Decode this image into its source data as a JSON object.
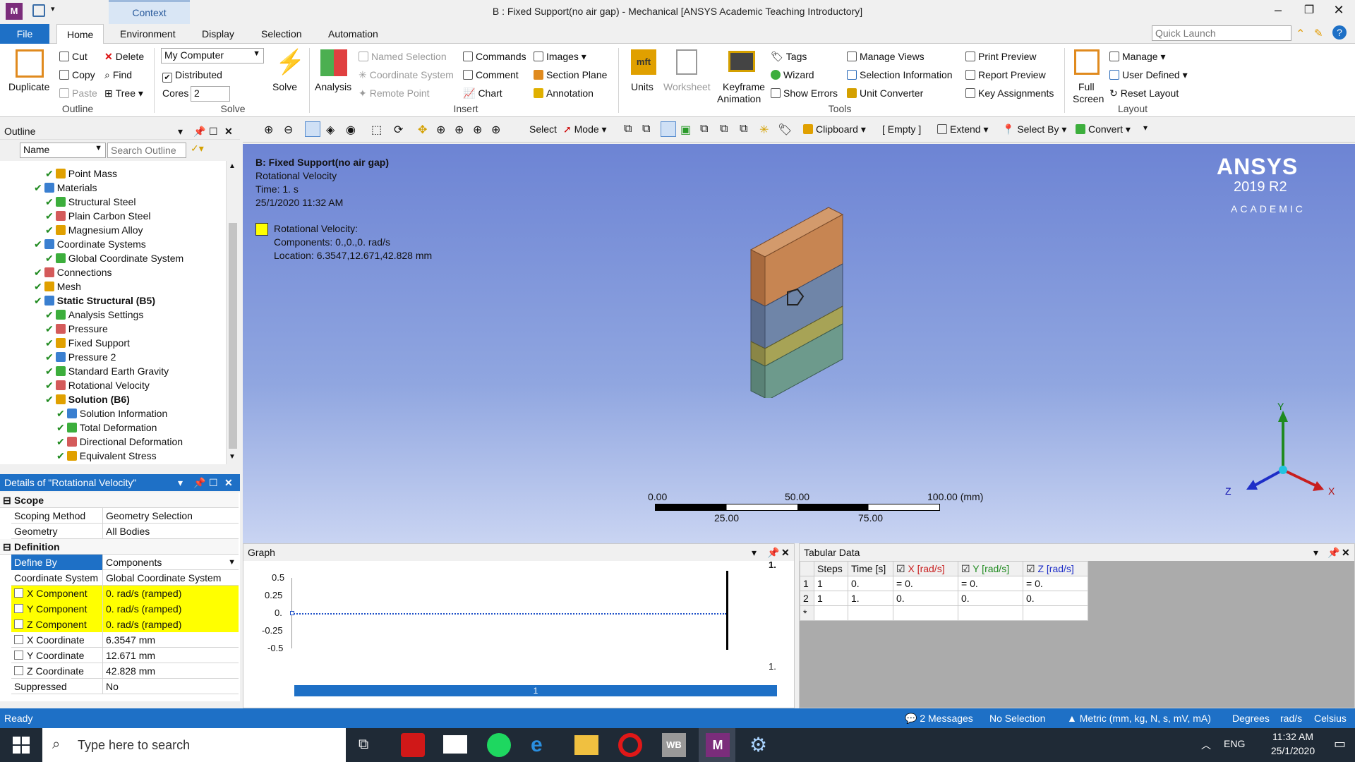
{
  "window": {
    "title": "B : Fixed Support(no air gap) - Mechanical [ANSYS Academic Teaching Introductory]",
    "context_tab": "Context"
  },
  "menu": {
    "file": "File",
    "tabs": [
      "Home",
      "Environment",
      "Display",
      "Selection",
      "Automation"
    ],
    "quick_launch_placeholder": "Quick Launch"
  },
  "ribbon": {
    "outline": {
      "duplicate": "Duplicate",
      "cut": "Cut",
      "copy": "Copy",
      "paste": "Paste",
      "delete": "Delete",
      "find": "Find",
      "tree": "Tree",
      "group": "Outline"
    },
    "solve": {
      "computer": "My Computer",
      "distributed": "Distributed",
      "cores_label": "Cores",
      "cores_value": "2",
      "solve": "Solve",
      "group": "Solve"
    },
    "insert": {
      "analysis": "Analysis",
      "named_selection": "Named Selection",
      "coordinate_system": "Coordinate System",
      "remote_point": "Remote Point",
      "commands": "Commands",
      "comment": "Comment",
      "chart": "Chart",
      "images": "Images",
      "section_plane": "Section Plane",
      "annotation": "Annotation",
      "group": "Insert"
    },
    "tools": {
      "units": "Units",
      "worksheet": "Worksheet",
      "keyframe": "Keyframe",
      "animation": "Animation",
      "tags": "Tags",
      "wizard": "Wizard",
      "show_errors": "Show Errors",
      "manage_views": "Manage Views",
      "selection_information": "Selection Information",
      "unit_converter": "Unit Converter",
      "print_preview": "Print Preview",
      "report_preview": "Report Preview",
      "key_assignments": "Key Assignments",
      "group": "Tools"
    },
    "layout": {
      "full": "Full",
      "screen": "Screen",
      "manage": "Manage",
      "user_defined": "User Defined",
      "reset_layout": "Reset Layout",
      "group": "Layout"
    }
  },
  "graphics_toolbar": {
    "select": "Select",
    "mode": "Mode",
    "clipboard": "Clipboard",
    "empty": "[ Empty ]",
    "extend": "Extend",
    "select_by": "Select By",
    "convert": "Convert"
  },
  "outline": {
    "title": "Outline",
    "name_filter": "Name",
    "search_placeholder": "Search Outline",
    "items": [
      {
        "label": "Point Mass",
        "level": 3,
        "bold": false
      },
      {
        "label": "Materials",
        "level": 2,
        "bold": false
      },
      {
        "label": "Structural Steel",
        "level": 3,
        "bold": false
      },
      {
        "label": "Plain Carbon Steel",
        "level": 3,
        "bold": false
      },
      {
        "label": "Magnesium Alloy",
        "level": 3,
        "bold": false
      },
      {
        "label": "Coordinate Systems",
        "level": 2,
        "bold": false
      },
      {
        "label": "Global Coordinate System",
        "level": 3,
        "bold": false
      },
      {
        "label": "Connections",
        "level": 2,
        "bold": false
      },
      {
        "label": "Mesh",
        "level": 2,
        "bold": false
      },
      {
        "label": "Static Structural (B5)",
        "level": 2,
        "bold": true
      },
      {
        "label": "Analysis Settings",
        "level": 3,
        "bold": false
      },
      {
        "label": "Pressure",
        "level": 3,
        "bold": false
      },
      {
        "label": "Fixed Support",
        "level": 3,
        "bold": false
      },
      {
        "label": "Pressure 2",
        "level": 3,
        "bold": false
      },
      {
        "label": "Standard Earth Gravity",
        "level": 3,
        "bold": false
      },
      {
        "label": "Rotational Velocity",
        "level": 3,
        "bold": false
      },
      {
        "label": "Solution (B6)",
        "level": 3,
        "bold": true
      },
      {
        "label": "Solution Information",
        "level": 4,
        "bold": false
      },
      {
        "label": "Total Deformation",
        "level": 4,
        "bold": false
      },
      {
        "label": "Directional Deformation",
        "level": 4,
        "bold": false
      },
      {
        "label": "Equivalent Stress",
        "level": 4,
        "bold": false
      }
    ]
  },
  "details": {
    "title": "Details of \"Rotational Velocity\"",
    "scope_label": "Scope",
    "definition_label": "Definition",
    "scope": [
      {
        "key": "Scoping Method",
        "value": "Geometry Selection"
      },
      {
        "key": "Geometry",
        "value": "All Bodies"
      }
    ],
    "definition": [
      {
        "key": "Define By",
        "value": "Components"
      },
      {
        "key": "Coordinate System",
        "value": "Global Coordinate System"
      },
      {
        "key": "X Component",
        "value": "0. rad/s  (ramped)"
      },
      {
        "key": "Y Component",
        "value": "0. rad/s  (ramped)"
      },
      {
        "key": "Z Component",
        "value": "0. rad/s  (ramped)"
      },
      {
        "key": "X Coordinate",
        "value": "6.3547 mm"
      },
      {
        "key": "Y Coordinate",
        "value": "12.671 mm"
      },
      {
        "key": "Z Coordinate",
        "value": "42.828 mm"
      },
      {
        "key": "Suppressed",
        "value": "No"
      }
    ]
  },
  "viewport": {
    "title": "B: Fixed Support(no air gap)",
    "subtitle": "Rotational Velocity",
    "time": "Time: 1. s",
    "date": "25/1/2020 11:32 AM",
    "legend_title": "Rotational Velocity:",
    "legend_components": "Components: 0.,0.,0. rad/s",
    "legend_location": "Location: 6.3547,12.671,42.828 mm",
    "brand": "ANSYS",
    "version": "2019 R2",
    "edition": "ACADEMIC",
    "scale_top": [
      "0.00",
      "50.00",
      "100.00 (mm)"
    ],
    "scale_bottom": [
      "25.00",
      "75.00"
    ],
    "axis_x": "X",
    "axis_y": "Y",
    "axis_z": "Z",
    "accent_color": "#ffff00"
  },
  "graph": {
    "title": "Graph",
    "y_ticks": [
      "0.5",
      "0.25",
      "0.",
      "-0.25",
      "-0.5"
    ],
    "top_marker": "1.",
    "bottom_marker": "1.",
    "timeline_label": "1"
  },
  "tabular": {
    "title": "Tabular Data",
    "headers": [
      "Steps",
      "Time [s]",
      "X [rad/s]",
      "Y [rad/s]",
      "Z [rad/s]"
    ],
    "rows": [
      {
        "n": "1",
        "steps": "1",
        "time": "0.",
        "x": "= 0.",
        "y": "= 0.",
        "z": "= 0."
      },
      {
        "n": "2",
        "steps": "1",
        "time": "1.",
        "x": "0.",
        "y": "0.",
        "z": "0."
      },
      {
        "n": "*",
        "steps": "",
        "time": "",
        "x": "",
        "y": "",
        "z": ""
      }
    ]
  },
  "status": {
    "ready": "Ready",
    "messages": "2 Messages",
    "selection": "No Selection",
    "units": "Metric (mm, kg, N, s, mV, mA)",
    "degrees": "Degrees",
    "rads": "rad/s",
    "temp": "Celsius"
  },
  "taskbar": {
    "search_placeholder": "Type here to search",
    "lang": "ENG",
    "time": "11:32 AM",
    "date": "25/1/2020"
  }
}
